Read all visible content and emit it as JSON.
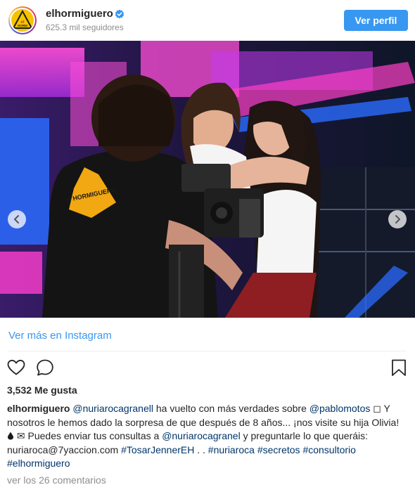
{
  "header": {
    "username": "elhormiguero",
    "followers": "625.3 mil seguidores",
    "view_profile_label": "Ver perfil",
    "avatar_logo_text": "el HORMIGUERO",
    "verified_color": "#3897f0"
  },
  "photo": {
    "shirt_logo_text": "el HORMIGUERO",
    "description_icon": "carousel-photo"
  },
  "view_more_label": "Ver más en Instagram",
  "actions": {
    "like_icon": "heart-outline-icon",
    "comment_icon": "speech-bubble-icon",
    "save_icon": "bookmark-icon"
  },
  "likes": "3,532 Me gusta",
  "caption": {
    "user": "elhormiguero",
    "t1": " ",
    "mention1": "@nuriarocagranell",
    "t2": " ha vuelto con más verdades sobre ",
    "mention2": "@pablomotos",
    "t3": " ◻ Y nosotros le hemos dado la sorpresa de que después de 8 años... ¡nos visite su hija Olivia! ",
    "t4": " ✉ Puedes enviar tus consultas a ",
    "mention3": "@nuriarocagranel",
    "t5": " y preguntarle lo que queráis: nuriaroca@7yaccion.com ",
    "tag1": "#TosarJennerEH",
    "t6": " . . ",
    "tag2": "#nuriaroca",
    "t7": " ",
    "tag3": "#secretos",
    "t8": " ",
    "tag4": "#consultorio",
    "t9": " ",
    "tag5": "#elhormiguero"
  },
  "comments_link": "ver los 26 comentarios",
  "colors": {
    "accent": "#3897f0",
    "link": "#003569",
    "muted": "#8e8e8e",
    "text": "#262626"
  }
}
